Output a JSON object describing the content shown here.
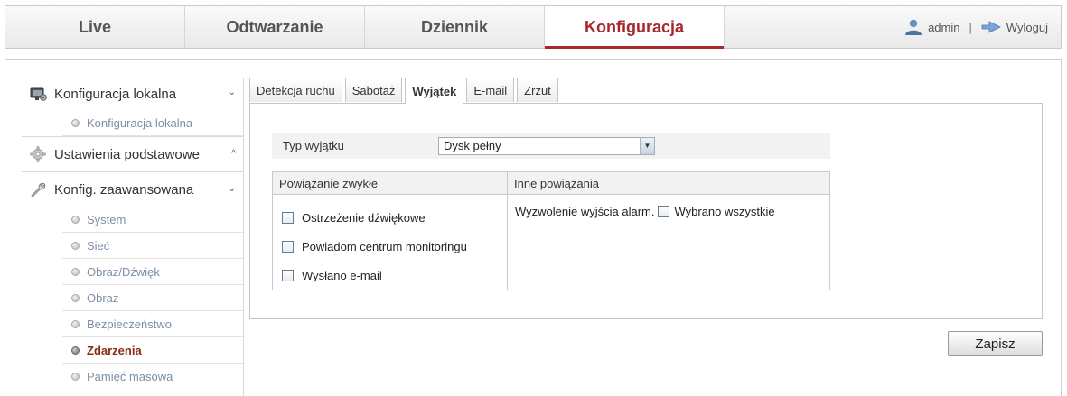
{
  "topnav": {
    "tabs": [
      {
        "label": "Live"
      },
      {
        "label": "Odtwarzanie"
      },
      {
        "label": "Dziennik"
      },
      {
        "label": "Konfiguracja"
      }
    ],
    "active_tab": "Konfiguracja",
    "user": "admin",
    "separator": "|",
    "logout": "Wyloguj"
  },
  "sidebar": {
    "sections": [
      {
        "label": "Konfiguracja lokalna",
        "chevron": "⌄",
        "icon": "monitor-gear-icon"
      },
      {
        "label": "Ustawienia podstawowe",
        "chevron": "^",
        "icon": "gear-icon"
      },
      {
        "label": "Konfig. zaawansowana",
        "chevron": "⌄",
        "icon": "wrench-icon"
      }
    ],
    "local_items": [
      "Konfiguracja lokalna"
    ],
    "advanced_items": [
      "System",
      "Sieć",
      "Obraz/Dźwięk",
      "Obraz",
      "Bezpieczeństwo",
      "Zdarzenia",
      "Pamięć masowa"
    ],
    "active_item": "Zdarzenia"
  },
  "subtabs": [
    "Detekcja ruchu",
    "Sabotaż",
    "Wyjątek",
    "E-mail",
    "Zrzut"
  ],
  "active_subtab": "Wyjątek",
  "form": {
    "type_label": "Typ wyjątku",
    "type_value": "Dysk pełny",
    "linkage": {
      "col1_header": "Powiązanie zwykłe",
      "col2_header": "Inne powiązania",
      "normal_options": [
        {
          "label": "Ostrzeżenie dźwiękowe",
          "checked": false
        },
        {
          "label": "Powiadom centrum monitoringu",
          "checked": false
        },
        {
          "label": "Wysłano e-mail",
          "checked": false
        }
      ],
      "other_label": "Wyzwolenie wyjścia alarm.",
      "select_all_label": "Wybrano wszystkie",
      "select_all_checked": false
    },
    "save_label": "Zapisz"
  },
  "colors": {
    "accent": "#a8272d",
    "active_menu": "#8a2c14",
    "submenu_text": "#7d8fa5"
  }
}
